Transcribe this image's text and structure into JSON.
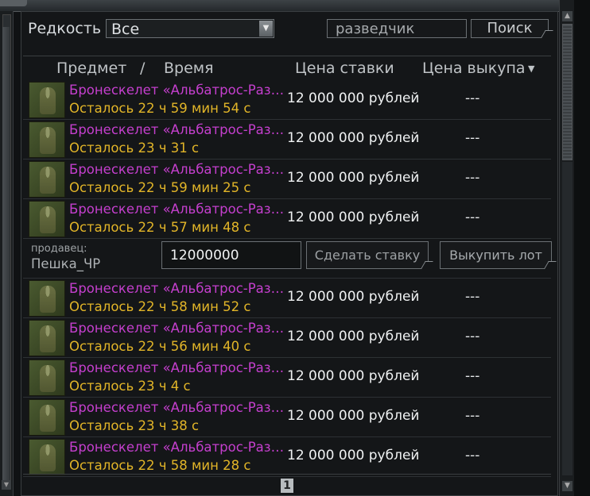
{
  "filter": {
    "rarity_label": "Редкость",
    "rarity_value": "Все"
  },
  "search": {
    "value": "разведчик",
    "button": "Поиск"
  },
  "columns": {
    "item": "Предмет",
    "separator": "/",
    "time": "Время",
    "bid_price": "Цена ставки",
    "buyout_price": "Цена выкупа"
  },
  "lots_before": [
    {
      "name": "Бронескелет «Альбатрос-Развед...",
      "time_left": "Осталось 22 ч 59 мин 54 с",
      "bid": "12 000 000 рублей",
      "buyout": "---"
    },
    {
      "name": "Бронескелет «Альбатрос-Развед...",
      "time_left": "Осталось 23 ч 31 с",
      "bid": "12 000 000 рублей",
      "buyout": "---"
    },
    {
      "name": "Бронескелет «Альбатрос-Развед...",
      "time_left": "Осталось 22 ч 59 мин 25 с",
      "bid": "12 000 000 рублей",
      "buyout": "---"
    },
    {
      "name": "Бронескелет «Альбатрос-Развед...",
      "time_left": "Осталось 22 ч 57 мин 48 с",
      "bid": "12 000 000 рублей",
      "buyout": "---"
    }
  ],
  "selected_lot": {
    "seller_label": "продавец:",
    "seller_name": "Пешка_ЧР",
    "bid_input": "12000000",
    "bid_button": "Сделать ставку",
    "buyout_button": "Выкупить лот"
  },
  "lots_after": [
    {
      "name": "Бронескелет «Альбатрос-Развед...",
      "time_left": "Осталось 22 ч 58 мин 52 с",
      "bid": "12 000 000 рублей",
      "buyout": "---"
    },
    {
      "name": "Бронескелет «Альбатрос-Развед...",
      "time_left": "Осталось 22 ч 56 мин 40 с",
      "bid": "12 000 000 рублей",
      "buyout": "---"
    },
    {
      "name": "Бронескелет «Альбатрос-Развед...",
      "time_left": "Осталось 23 ч 4 с",
      "bid": "12 000 000 рублей",
      "buyout": "---"
    },
    {
      "name": "Бронескелет «Альбатрос-Развед...",
      "time_left": "Осталось 23 ч 38 с",
      "bid": "12 000 000 рублей",
      "buyout": "---"
    },
    {
      "name": "Бронескелет «Альбатрос-Развед...",
      "time_left": "Осталось 22 ч 58 мин 28 с",
      "bid": "12 000 000 рублей",
      "buyout": "---"
    }
  ],
  "pager": {
    "current_page": "1"
  },
  "icons": {
    "item": "armor-exoskeleton-icon",
    "dropdown": "triangle-down-icon",
    "sort": "sort-down-icon"
  },
  "colors": {
    "item_name": "#c53fce",
    "time_left": "#e2b528",
    "text": "#f0f2f3"
  }
}
